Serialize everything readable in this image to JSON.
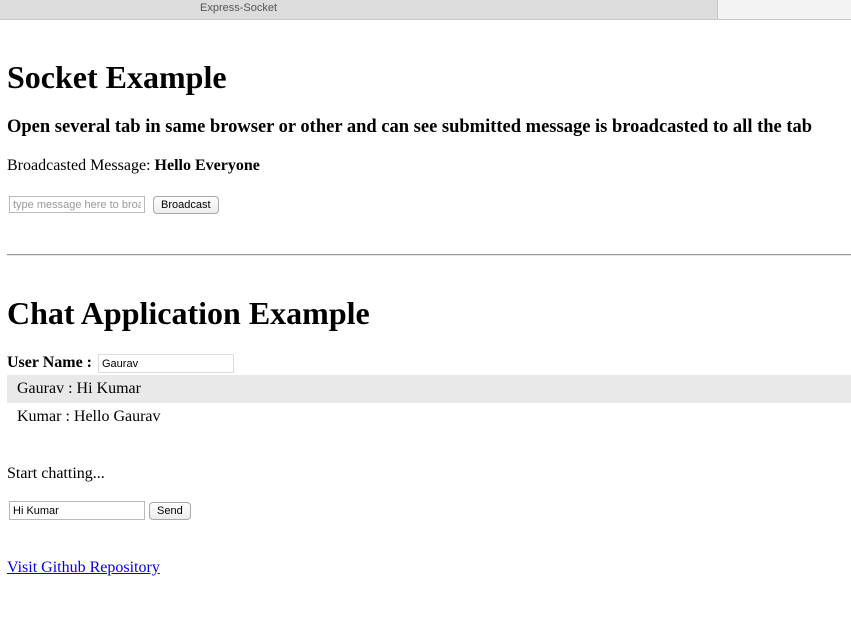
{
  "browser": {
    "tab_title": "Express-Socket"
  },
  "socket_section": {
    "heading": "Socket Example",
    "subheading": "Open several tab in same browser or other and can see submitted message is broadcasted to all the tab",
    "broadcast_label": "Broadcasted Message:",
    "broadcast_value": "Hello Everyone",
    "message_input": {
      "placeholder": "type message here to broadcast",
      "value": ""
    },
    "broadcast_button": "Broadcast"
  },
  "chat_section": {
    "heading": "Chat Application Example",
    "username_label": "User Name :",
    "username_value": "Gaurav",
    "messages": [
      {
        "sender": "Gaurav",
        "separator": " : ",
        "text": "Hi Kumar"
      },
      {
        "sender": "Kumar",
        "separator": " : ",
        "text": "Hello Gaurav"
      }
    ],
    "status": "Start chatting...",
    "chat_input_value": "Hi Kumar",
    "send_button": "Send"
  },
  "footer": {
    "github_link": "Visit Github Repository"
  },
  "colors": {
    "link": "#0000ee",
    "alt_row": "#e9e9e9",
    "tab_active": "#dcdcdc"
  }
}
